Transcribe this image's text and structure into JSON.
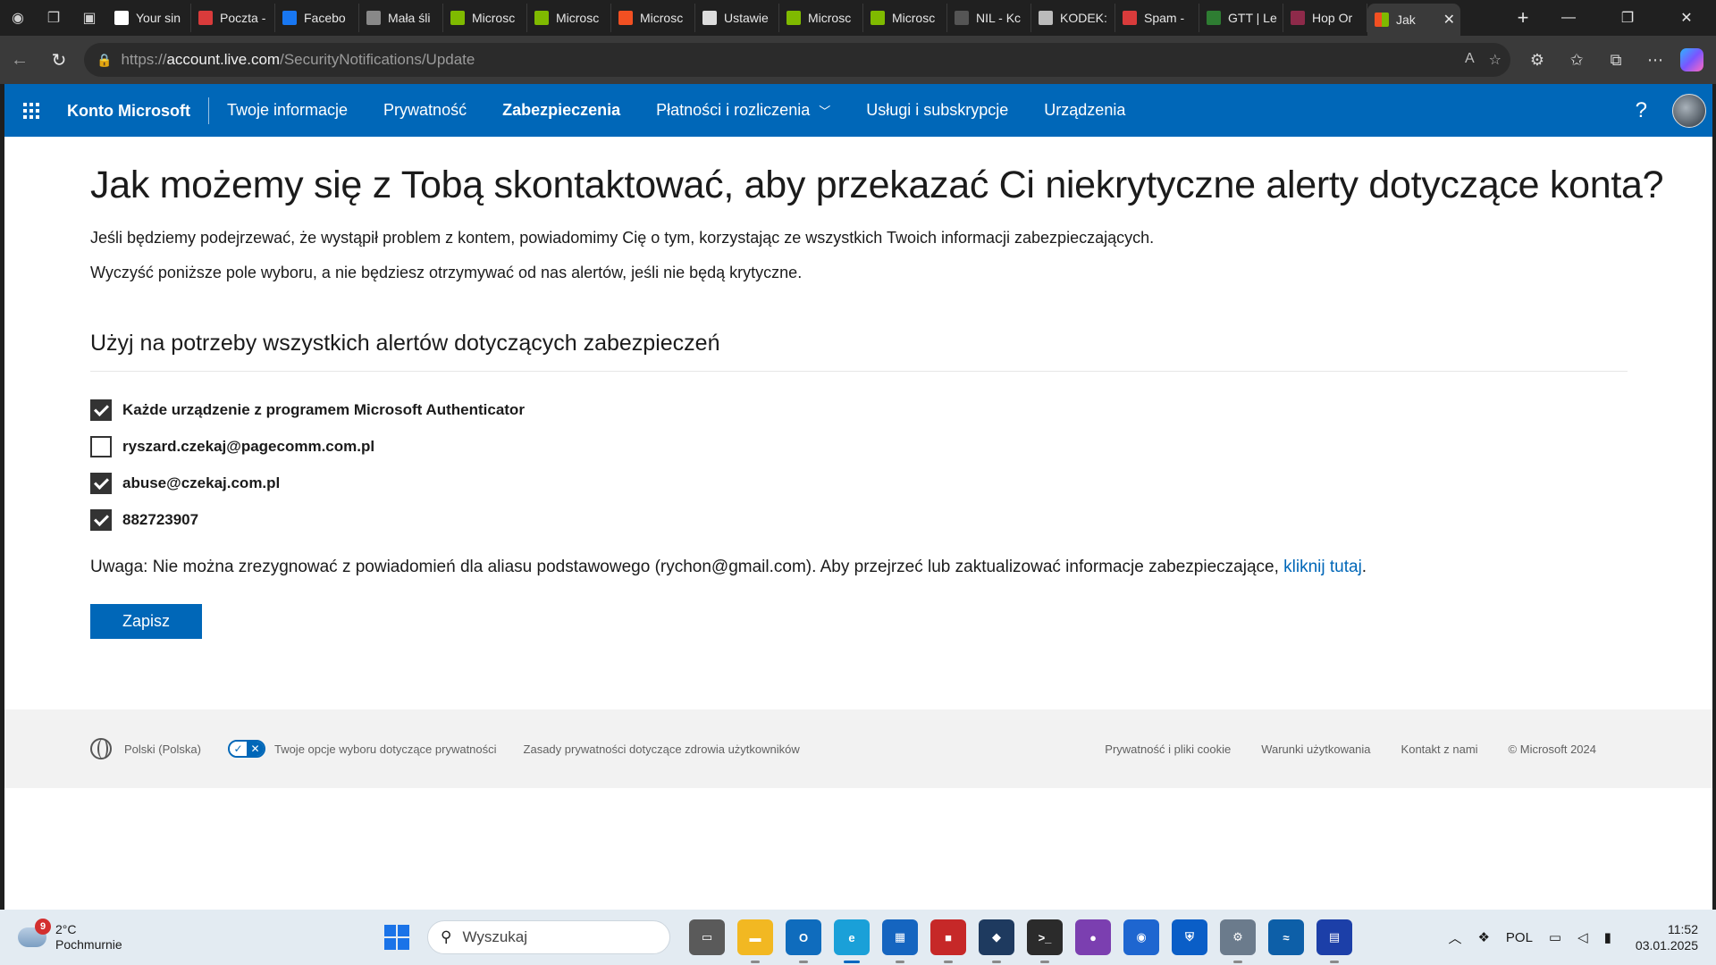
{
  "browser": {
    "tabs": [
      {
        "title": "Your sin",
        "icon": "gmail-icon",
        "color": "#ffffff"
      },
      {
        "title": "Poczta -",
        "icon": "mail-icon",
        "color": "#d93b3b"
      },
      {
        "title": "Facebo",
        "icon": "facebook-icon",
        "color": "#1877f2"
      },
      {
        "title": "Mała śli",
        "icon": "site-icon",
        "color": "#888888"
      },
      {
        "title": "Microsc",
        "icon": "microsoft-icon",
        "color": "#7fba00"
      },
      {
        "title": "Microsc",
        "icon": "microsoft-icon",
        "color": "#7fba00"
      },
      {
        "title": "Microsc",
        "icon": "microsoft-icon",
        "color": "#f25022"
      },
      {
        "title": "Ustawie",
        "icon": "google-icon",
        "color": "#dddddd"
      },
      {
        "title": "Microsc",
        "icon": "microsoft-icon",
        "color": "#7fba00"
      },
      {
        "title": "Microsc",
        "icon": "microsoft-icon",
        "color": "#7fba00"
      },
      {
        "title": "NIL - Kc",
        "icon": "nil-icon",
        "color": "#555555"
      },
      {
        "title": "KODEK:",
        "icon": "document-icon",
        "color": "#bbbbbb"
      },
      {
        "title": "Spam -",
        "icon": "mail-icon",
        "color": "#d93b3b"
      },
      {
        "title": "GTT | Le",
        "icon": "site-icon",
        "color": "#2e7d32"
      },
      {
        "title": "Hop Or",
        "icon": "site-icon",
        "color": "#8e2a4a"
      }
    ],
    "active_tab": {
      "title": "Jak",
      "icon": "microsoft-icon"
    },
    "url_prefix": "https://",
    "url_domain": "account.live.com",
    "url_path": "/SecurityNotifications/Update"
  },
  "header": {
    "brand": "Konto Microsoft",
    "nav": [
      "Twoje informacje",
      "Prywatność",
      "Zabezpieczenia",
      "Płatności i rozliczenia",
      "Usługi i subskrypcje",
      "Urządzenia"
    ],
    "active_nav": "Zabezpieczenia",
    "help": "?"
  },
  "main": {
    "title": "Jak możemy się z Tobą skontaktować, aby przekazać Ci niekrytyczne alerty dotyczące konta?",
    "paragraph1": "Jeśli będziemy podejrzewać, że wystąpił problem z kontem, powiadomimy Cię o tym, korzystając ze wszystkich Twoich informacji zabezpieczających.",
    "paragraph2": "Wyczyść poniższe pole wyboru, a nie będziesz otrzymywać od nas alertów, jeśli nie będą krytyczne.",
    "section_title": "Użyj na potrzeby wszystkich alertów dotyczących zabezpieczeń",
    "options": [
      {
        "label": "Każde urządzenie z programem Microsoft Authenticator",
        "checked": true
      },
      {
        "label": "ryszard.czekaj@pagecomm.com.pl",
        "checked": false
      },
      {
        "label": "abuse@czekaj.com.pl",
        "checked": true
      },
      {
        "label": "882723907",
        "checked": true
      }
    ],
    "note_text": "Uwaga: Nie można zrezygnować z powiadomień dla aliasu podstawowego (rychon@gmail.com). Aby przejrzeć lub zaktualizować informacje zabezpieczające, ",
    "note_link": "kliknij tutaj",
    "note_end": ".",
    "save_label": "Zapisz"
  },
  "footer": {
    "language": "Polski (Polska)",
    "privacy_choices": "Twoje opcje wyboru dotyczące prywatności",
    "health_privacy": "Zasady prywatności dotyczące zdrowia użytkowników",
    "privacy_cookies": "Prywatność i pliki cookie",
    "terms": "Warunki użytkowania",
    "contact": "Kontakt z nami",
    "copyright": "© Microsoft 2024"
  },
  "taskbar": {
    "weather_badge": "9",
    "temperature": "2°C",
    "condition": "Pochmurnie",
    "search_placeholder": "Wyszukaj",
    "language": "POL",
    "time": "11:52",
    "date": "03.01.2025"
  },
  "colors": {
    "accent": "#0067b8",
    "header_bg": "#0067b8"
  }
}
